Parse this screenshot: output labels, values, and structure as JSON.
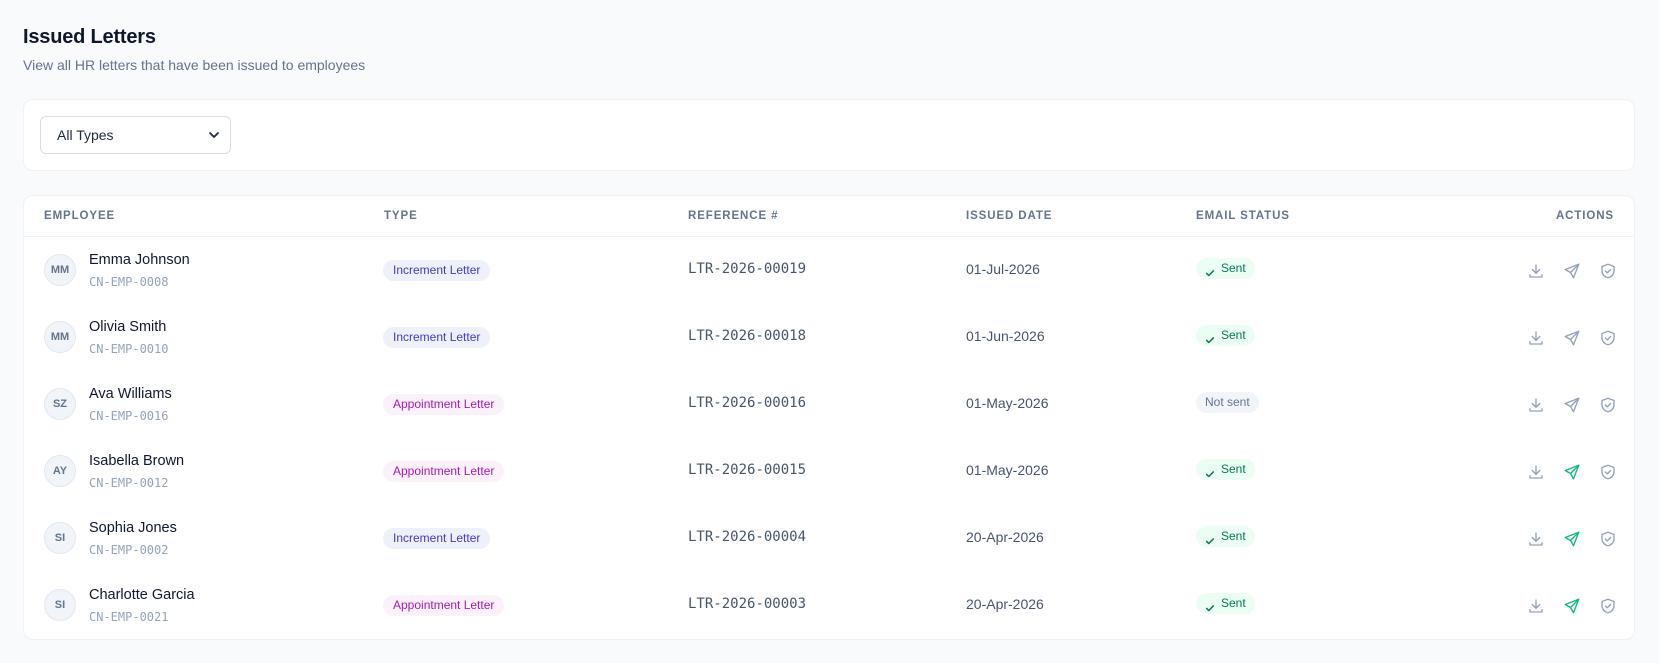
{
  "header": {
    "title": "Issued Letters",
    "subtitle": "View all HR letters that have been issued to employees"
  },
  "filter": {
    "selected": "All Types"
  },
  "table": {
    "columns": {
      "employee": "EMPLOYEE",
      "type": "TYPE",
      "reference": "REFERENCE #",
      "issued_date": "ISSUED DATE",
      "email_status": "EMAIL STATUS",
      "actions": "ACTIONS"
    },
    "rows": [
      {
        "initials": "MM",
        "name": "Emma Johnson",
        "code": "CN-EMP-0008",
        "type": "Increment Letter",
        "reference": "LTR-2026-00019",
        "date": "01-Jul-2026",
        "status": "Sent"
      },
      {
        "initials": "MM",
        "name": "Olivia Smith",
        "code": "CN-EMP-0010",
        "type": "Increment Letter",
        "reference": "LTR-2026-00018",
        "date": "01-Jun-2026",
        "status": "Sent"
      },
      {
        "initials": "SZ",
        "name": "Ava Williams",
        "code": "CN-EMP-0016",
        "type": "Appointment Letter",
        "reference": "LTR-2026-00016",
        "date": "01-May-2026",
        "status": "Not sent"
      },
      {
        "initials": "AY",
        "name": "Isabella Brown",
        "code": "CN-EMP-0012",
        "type": "Appointment Letter",
        "reference": "LTR-2026-00015",
        "date": "01-May-2026",
        "status": "Sent"
      },
      {
        "initials": "SI",
        "name": "Sophia Jones",
        "code": "CN-EMP-0002",
        "type": "Increment Letter",
        "reference": "LTR-2026-00004",
        "date": "20-Apr-2026",
        "status": "Sent"
      },
      {
        "initials": "SI",
        "name": "Charlotte Garcia",
        "code": "CN-EMP-0021",
        "type": "Appointment Letter",
        "reference": "LTR-2026-00003",
        "date": "20-Apr-2026",
        "status": "Sent"
      }
    ]
  },
  "icons": {
    "download": "download-icon",
    "send": "send-icon",
    "verify": "shield-check-icon",
    "check": "check-icon",
    "chevron": "chevron-down-icon"
  },
  "colors": {
    "send_active": "#10b981",
    "icon_idle": "#94a3b8"
  }
}
